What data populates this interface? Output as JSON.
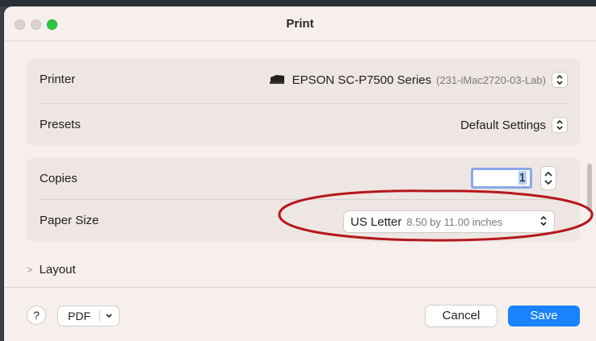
{
  "window": {
    "title": "Print"
  },
  "printer": {
    "label": "Printer",
    "name": "EPSON SC-P7500 Series",
    "location": "(231-iMac2720-03-Lab)",
    "icon": "printer-icon"
  },
  "presets": {
    "label": "Presets",
    "value": "Default Settings"
  },
  "copies": {
    "label": "Copies",
    "value": "1"
  },
  "paper_size": {
    "label": "Paper Size",
    "value": "US Letter",
    "detail": "8.50 by 11.00 inches"
  },
  "layout": {
    "label": "Layout"
  },
  "footer": {
    "help_label": "?",
    "pdf_label": "PDF",
    "cancel_label": "Cancel",
    "save_label": "Save"
  },
  "colors": {
    "accent": "#1a82fb",
    "annotation": "#b5161c",
    "traffic_green": "#2cc840"
  }
}
